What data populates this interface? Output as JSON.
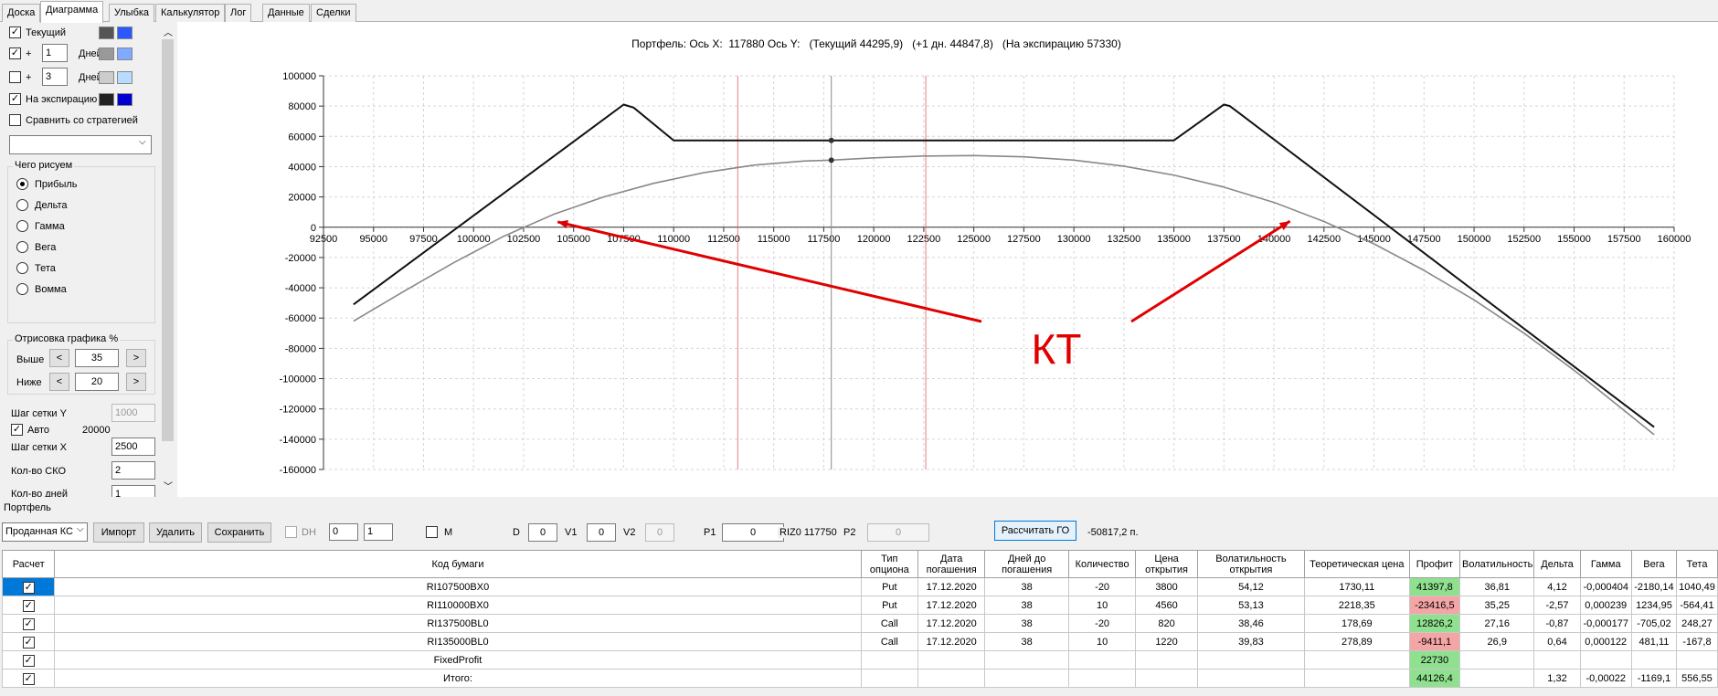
{
  "tabs": [
    "Доска",
    "Диаграмма",
    "Улыбка",
    "Калькулятор",
    "Лог",
    "Данные",
    "Сделки"
  ],
  "left": {
    "tekushiy": "Текущий",
    "plus1": "+",
    "plus1_val": "1",
    "days1": "Дней",
    "plus2": "+",
    "plus2_val": "3",
    "days2": "Дней",
    "expiry": "На экспирацию",
    "compare": "Сравнить со стратегией",
    "chego_title": "Чего рисуем",
    "radios": [
      "Прибыль",
      "Дельта",
      "Гамма",
      "Вега",
      "Тета",
      "Вомма"
    ],
    "otris_title": "Отрисовка графика %",
    "vyshe": "Выше",
    "vyshe_val": "35",
    "nizhe": "Ниже",
    "nizhe_val": "20",
    "lt": "<",
    "gt": ">",
    "grid_y": "Шаг сетки Y",
    "grid_y_val": "1000",
    "auto": "Авто",
    "auto_val": "20000",
    "grid_x": "Шаг сетки X",
    "grid_x_val": "2500",
    "sko": "Кол-во СКО",
    "sko_val": "2",
    "kol_dney": "Кол-во дней",
    "kol_dney_val": "1"
  },
  "colors": {
    "tek1": "#555555",
    "tek2": "#2b59ff",
    "p1a": "#999999",
    "p1b": "#80aaff",
    "p2a": "#cccccc",
    "p2b": "#b8dcff",
    "ex1": "#222222",
    "ex2": "#0000d0"
  },
  "chart": {
    "title": "Портфель: Ось Х:  117880 Ось Y:   (Текущий 44295,9)   (+1 дн. 44847,8)   (На экспирацию 57330)",
    "annotation": "КТ"
  },
  "chart_data": {
    "type": "line",
    "xlim": [
      92500,
      160000
    ],
    "ylim": [
      -160000,
      100000
    ],
    "xticks": [
      "92500",
      "95000",
      "97500",
      "100000",
      "102500",
      "105000",
      "107500",
      "110000",
      "112500",
      "115000",
      "117500",
      "120000",
      "122500",
      "125000",
      "127500",
      "130000",
      "132500",
      "135000",
      "137500",
      "140000",
      "142500",
      "145000",
      "147500",
      "150000",
      "152500",
      "155000",
      "157500",
      "160000"
    ],
    "yticks": [
      "100000",
      "80000",
      "60000",
      "40000",
      "20000",
      "0",
      "-20000",
      "-40000",
      "-60000",
      "-80000",
      "-100000",
      "-120000",
      "-140000",
      "-160000"
    ],
    "grid": true,
    "series": [
      {
        "x": [
          94000,
          107500,
          108000,
          110000,
          135000,
          137500,
          137800,
          159000
        ],
        "y": [
          -51000,
          81000,
          79000,
          57330,
          57330,
          81000,
          80000,
          -132000
        ]
      },
      {
        "x": [
          94000,
          96500,
          99000,
          101500,
          104000,
          106500,
          109000,
          111500,
          114000,
          116500,
          117880,
          120000,
          122500,
          125000,
          127500,
          130000,
          132500,
          135000,
          137500,
          140000,
          142500,
          145000,
          147500,
          150000,
          152500,
          155000,
          157500,
          159000
        ],
        "y": [
          -62000,
          -42500,
          -23500,
          -6000,
          8500,
          20000,
          29000,
          36000,
          41000,
          43700,
          44296,
          45800,
          47000,
          47300,
          46500,
          44300,
          40300,
          34400,
          26500,
          16400,
          3800,
          -11000,
          -28500,
          -48000,
          -70000,
          -94500,
          -121000,
          -137000
        ]
      }
    ],
    "vlines": [
      113200,
      117880,
      122600
    ],
    "markers": [
      [
        117880,
        57330
      ],
      [
        117880,
        44296
      ]
    ]
  },
  "bottom": {
    "portfel": "Портфель",
    "combo": "Проданная КС",
    "import": "Импорт",
    "delete": "Удалить",
    "save": "Сохранить",
    "dh": "DH",
    "dh1": "0",
    "dh2": "1",
    "m": "M",
    "d": "D",
    "d_val": "0",
    "v1": "V1",
    "v1_val": "0",
    "v2": "V2",
    "v2_val": "0",
    "p1": "P1",
    "p1_val": "0",
    "riz": "RIZ0 117750",
    "p2": "P2",
    "p2_val": "0",
    "calc": "Рассчитать ГО",
    "go": "-50817,2 п."
  },
  "table": {
    "headers": [
      "Расчет",
      "Код бумаги",
      "Тип опциона",
      "Дата погашения",
      "Дней до погашения",
      "Количество",
      "Цена открытия",
      "Волатильность открытия",
      "Теоретическая цена",
      "Профит",
      "Волатильность",
      "Дельта",
      "Гамма",
      "Вега",
      "Тета"
    ],
    "rows": [
      [
        "RI107500BX0",
        "Put",
        "17.12.2020",
        "38",
        "-20",
        "3800",
        "54,12",
        "1730,11",
        "41397,8",
        "36,81",
        "4,12",
        "-0,000404",
        "-2180,14",
        "1040,49"
      ],
      [
        "RI110000BX0",
        "Put",
        "17.12.2020",
        "38",
        "10",
        "4560",
        "53,13",
        "2218,35",
        "-23416,5",
        "35,25",
        "-2,57",
        "0,000239",
        "1234,95",
        "-564,41"
      ],
      [
        "RI137500BL0",
        "Call",
        "17.12.2020",
        "38",
        "-20",
        "820",
        "38,46",
        "178,69",
        "12826,2",
        "27,16",
        "-0,87",
        "-0,000177",
        "-705,02",
        "248,27"
      ],
      [
        "RI135000BL0",
        "Call",
        "17.12.2020",
        "38",
        "10",
        "1220",
        "39,83",
        "278,89",
        "-9411,1",
        "26,9",
        "0,64",
        "0,000122",
        "481,11",
        "-167,8"
      ],
      [
        "FixedProfit",
        "",
        "",
        "",
        "",
        "",
        "",
        "",
        "22730",
        "",
        "",
        "",
        "",
        ""
      ],
      [
        "Итого:",
        "",
        "",
        "",
        "",
        "",
        "",
        "",
        "44126,4",
        "",
        "1,32",
        "-0,00022",
        "-1169,1",
        "556,55"
      ]
    ]
  }
}
